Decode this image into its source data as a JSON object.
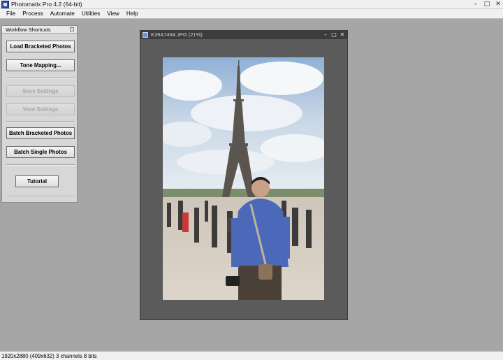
{
  "app": {
    "title": "Photomatix Pro 4.2 (64-bit)",
    "window_controls": [
      "–",
      "□",
      "✕"
    ]
  },
  "menu": [
    "File",
    "Process",
    "Automate",
    "Utilities",
    "View",
    "Help"
  ],
  "workflow_panel": {
    "title": "Workflow Shortcuts",
    "buttons": {
      "load_bracketed": "Load Bracketed Photos",
      "tone_mapping": "Tone Mapping...",
      "save_settings": "Save Settings",
      "view_settings": "View Settings",
      "batch_bracketed": "Batch Bracketed Photos",
      "batch_single": "Batch Single Photos",
      "tutorial": "Tutorial"
    }
  },
  "image_window": {
    "title": "K39A7494.JPG (21%)",
    "controls": [
      "–",
      "□",
      "✕"
    ]
  },
  "status": {
    "text": "1920x2880 (409x632) 3 channels 8 bits"
  },
  "colors": {
    "workspace": "#a6a6a6",
    "panel": "#d7d7d7",
    "image_window": "#5b5b5b"
  },
  "icons": {
    "app": "photomatix-app-icon",
    "doc": "image-document-icon"
  }
}
